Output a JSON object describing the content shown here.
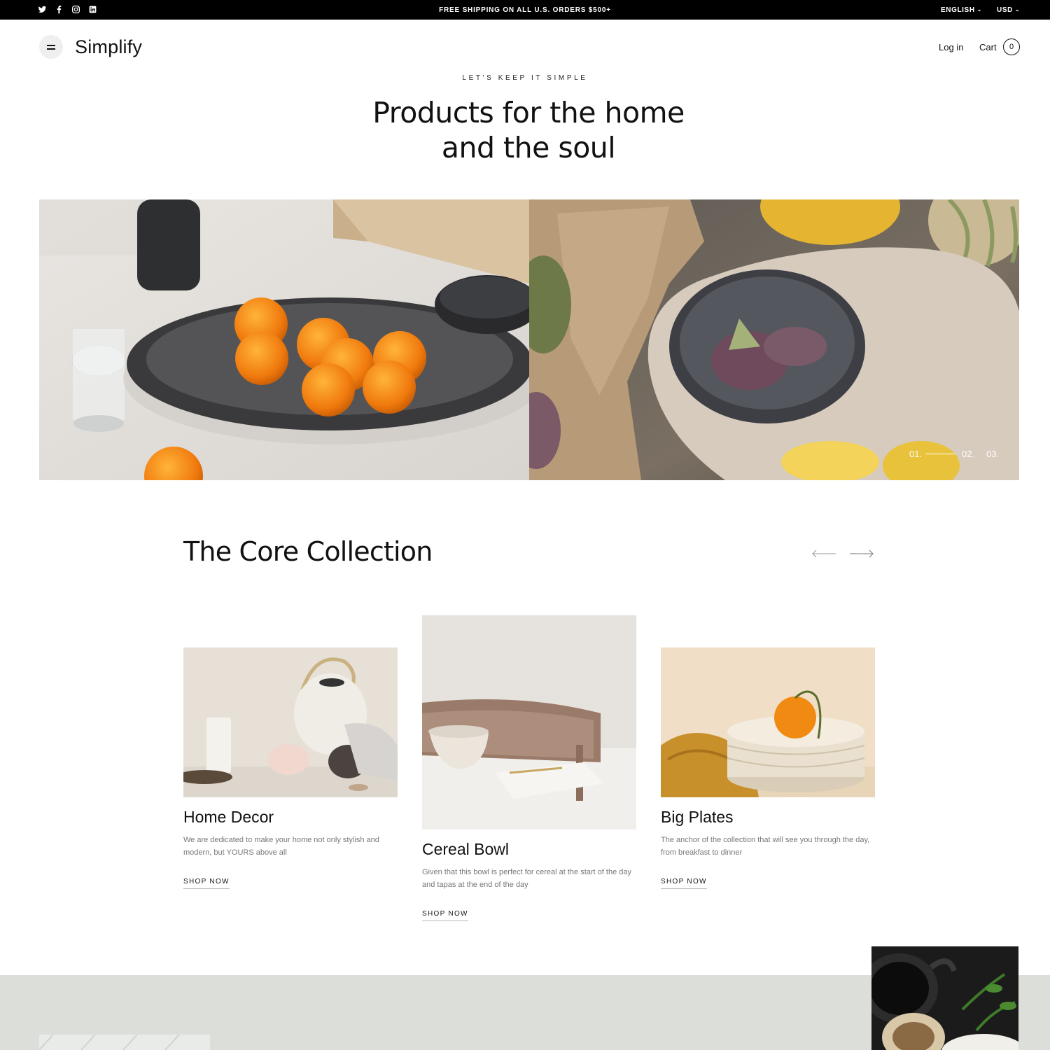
{
  "announcement": {
    "text": "FREE SHIPPING ON ALL U.S. ORDERS $500+",
    "social_icons": [
      "twitter-icon",
      "facebook-icon",
      "instagram-icon",
      "linkedin-icon"
    ],
    "language": "ENGLISH",
    "currency": "USD"
  },
  "header": {
    "logo": "Simplify",
    "login": "Log in",
    "cart_label": "Cart",
    "cart_count": "0"
  },
  "hero": {
    "eyebrow": "LET'S KEEP IT SIMPLE",
    "title_line1": "Products for the home",
    "title_line2": "and the soul",
    "slides": [
      "01.",
      "02.",
      "03."
    ],
    "active_slide": "01."
  },
  "collection": {
    "title": "The Core Collection",
    "cards": [
      {
        "title": "Home Decor",
        "description": "We are dedicated to make your home not only stylish and modern, but YOURS above all",
        "link": "SHOP NOW"
      },
      {
        "title": "Cereal Bowl",
        "description": "Given that this bowl is perfect for cereal at the start of the day and tapas at the end of the day",
        "link": "SHOP NOW"
      },
      {
        "title": "Big Plates",
        "description": "The anchor of the collection that will see you through the day, from breakfast to dinner",
        "link": "SHOP NOW"
      }
    ]
  },
  "colors": {
    "topbar": "#000000",
    "band": "#dcdfd9",
    "text": "#111111",
    "muted": "#777777"
  }
}
